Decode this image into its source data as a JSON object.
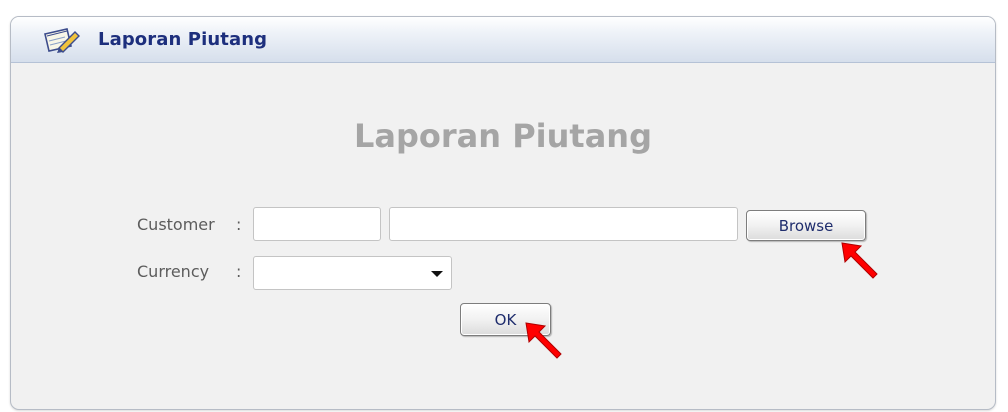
{
  "window": {
    "title": "Laporan Piutang",
    "icon": "notepad-pencil-icon"
  },
  "form": {
    "heading": "Laporan Piutang",
    "customer_label": "Customer",
    "customer_separator": ":",
    "customer_code_value": "",
    "customer_name_value": "",
    "browse_label": "Browse",
    "currency_label": "Currency",
    "currency_separator": ":",
    "currency_selected": "",
    "ok_label": "OK"
  },
  "annotations": {
    "pointer_icon": "red-arrow-pointer-icon",
    "pointer_color": "#ff0000"
  },
  "colors": {
    "title_text": "#1d2f7d",
    "heading_text": "#a5a5a5",
    "button_text": "#1f2d6d"
  }
}
